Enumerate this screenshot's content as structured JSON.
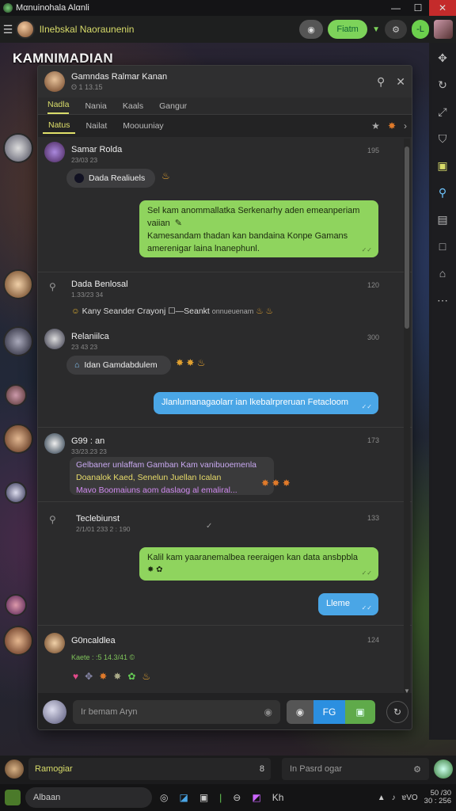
{
  "window": {
    "title": "Mαnuinohala Alαnli"
  },
  "topbar": {
    "title": "lInebskal Naoraunenin",
    "btn_green": "Fiatm",
    "btn_right": "-L"
  },
  "page": {
    "title": "KAMNIMADIAN"
  },
  "chat": {
    "header": {
      "name": "Gamndas Ralmar Kanan",
      "sub": "ʘ 1 13.15"
    },
    "tabs1": [
      "Nadla",
      "Nania",
      "Kaals",
      "Gangur"
    ],
    "tabs2": [
      "Natus",
      "Nailat",
      "Moouuniay"
    ],
    "messages": {
      "m1": {
        "name": "Samar Rolda",
        "sub": "23/03 23",
        "time": "195",
        "chip": "Dada Realiuels"
      },
      "b1": {
        "line1": "Sel kam anommallatka Serkenarhy aden emeanperiam",
        "line2": "vaiian",
        "line3": "Kamesandam thadan kan bandaina Konpe Gamans",
        "line4": "amerenigar laina lnanephunl."
      },
      "m2": {
        "name": "Dada Benlosal",
        "sub": "1.33/23 34",
        "time": "120",
        "line": "Kany Seander Crayonj ☐—Seankt",
        "line_sub": "onnueuenam"
      },
      "m3": {
        "name": "Relaniilca",
        "sub": "23 43 23",
        "time": "300",
        "chip": "Idan Gamdabdulem"
      },
      "b2": {
        "text": "Jlanlumanagaolarr ian lkebalrpreruan Fetacloom"
      },
      "m4": {
        "name": "G99 : an",
        "sub": "33/23.23 23",
        "time": "173",
        "l1": "Gelbaner unlaffam Gamban Kam vanibuoemenla",
        "l2": "Doanalok Kaed, Senelun Juellan Icalan",
        "l3": "Mavo Boomaiuns aom daslaog al emaliral..."
      },
      "m5": {
        "name": "Teclebiunst",
        "sub": "2/1/01 233 2 : 190",
        "time": "133"
      },
      "b3": {
        "text": "Kalil kam yaaranemalbea reeraigen kan data ansbpbla"
      },
      "b4": {
        "text": "Lleme"
      },
      "m6": {
        "name": "G0ncaldlea",
        "sub": "Kaete : :5 14.3/41 ©",
        "time": "124"
      }
    },
    "composer": {
      "placeholder": "Ir bemam Aryn",
      "btn_blue": "FG"
    }
  },
  "bottom": {
    "field": "Ramogiar",
    "field_icon": "8",
    "search": "In Pasrd ogar"
  },
  "taskbar": {
    "search": "Albaan",
    "kh": "Kh",
    "tray": "ɐVO",
    "time1": "50 /30",
    "time2": "30 : 256"
  },
  "colors": {
    "accent": "#d8dc6a",
    "green": "#8fd45e",
    "blue": "#4aa6e6"
  }
}
